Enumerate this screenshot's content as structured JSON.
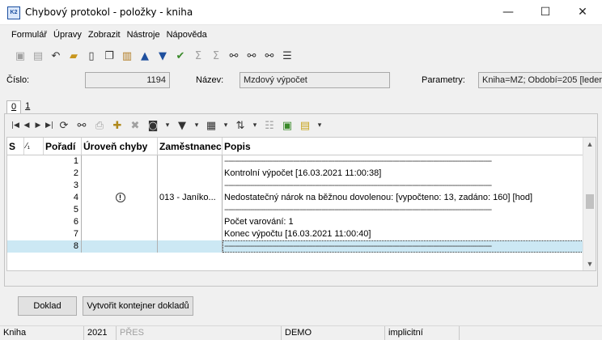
{
  "window": {
    "icon_text": "K2",
    "title": "Chybový protokol - položky - kniha",
    "minimize": "—",
    "maximize": "☐",
    "close": "✕"
  },
  "menu": [
    {
      "label": "Formulář"
    },
    {
      "label": "Úpravy"
    },
    {
      "label": "Zobrazit"
    },
    {
      "label": "Nástroje"
    },
    {
      "label": "Nápověda"
    }
  ],
  "header": {
    "cislo_label": "Číslo:",
    "cislo_value": "1194",
    "nazev_label": "Název:",
    "nazev_value": "Mzdový výpočet",
    "parametry_label": "Parametry:",
    "parametry_value": "Kniha=MZ; Období=205 [leden"
  },
  "tabs": [
    {
      "label": "0"
    },
    {
      "label": "1"
    }
  ],
  "grid": {
    "columns": [
      "S",
      "⁄₁",
      "Pořadí",
      "Úroveň chyby",
      "Zaměstnanec",
      "Popis"
    ],
    "rows": [
      {
        "poradi": "1",
        "uroven": "",
        "zamestnanec": "",
        "popis": "----------------------------------------------------------------------------------------------------------------------------"
      },
      {
        "poradi": "2",
        "uroven": "",
        "zamestnanec": "",
        "popis": "Kontrolní výpočet [16.03.2021 11:00:38]"
      },
      {
        "poradi": "3",
        "uroven": "",
        "zamestnanec": "",
        "popis": "----------------------------------------------------------------------------------------------------------------------------"
      },
      {
        "poradi": "4",
        "uroven": "!",
        "zamestnanec": "013 - Janíko...",
        "popis": "Nedostatečný nárok na běžnou dovolenou: [vypočteno: 13, zadáno: 160] [hod]"
      },
      {
        "poradi": "5",
        "uroven": "",
        "zamestnanec": "",
        "popis": "----------------------------------------------------------------------------------------------------------------------------"
      },
      {
        "poradi": "6",
        "uroven": "",
        "zamestnanec": "",
        "popis": "Počet varování: 1"
      },
      {
        "poradi": "7",
        "uroven": "",
        "zamestnanec": "",
        "popis": "Konec výpočtu [16.03.2021 11:00:40]"
      },
      {
        "poradi": "8",
        "uroven": "",
        "zamestnanec": "",
        "popis": "----------------------------------------------------------------------------------------------------------------------------"
      }
    ]
  },
  "buttons": {
    "doklad": "Doklad",
    "kontejner": "Vytvořit kontejner dokladů"
  },
  "status": {
    "kniha": "Kniha",
    "year": "2021",
    "pres": "PŘES",
    "demo": "DEMO",
    "implicit": "implicitní"
  }
}
